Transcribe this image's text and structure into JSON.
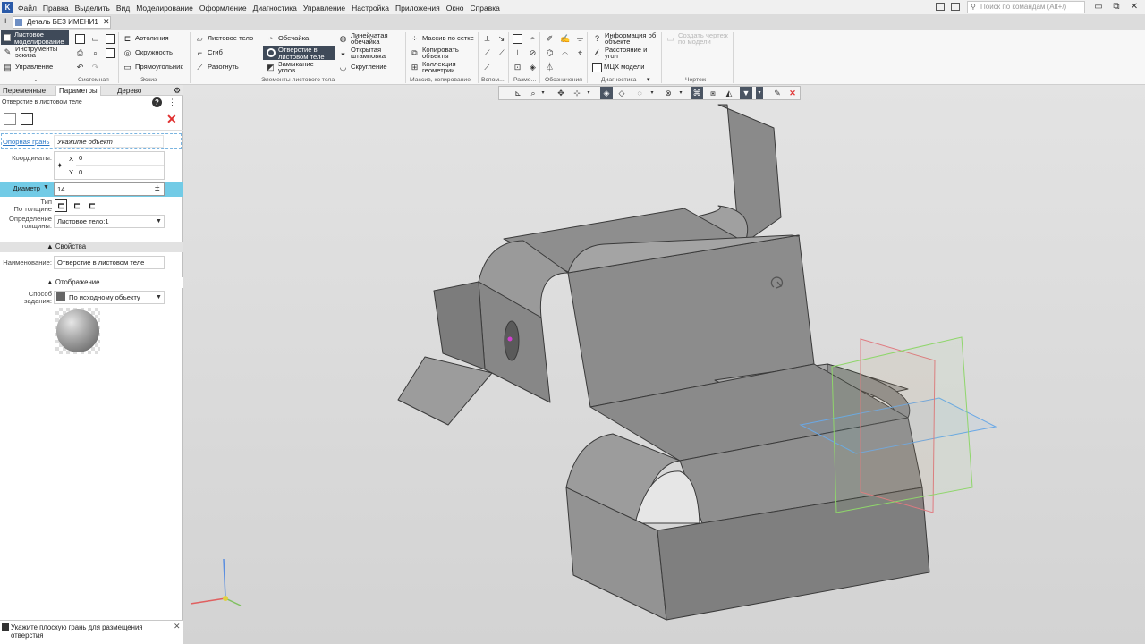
{
  "menu": {
    "items": [
      "Файл",
      "Правка",
      "Выделить",
      "Вид",
      "Моделирование",
      "Оформление",
      "Диагностика",
      "Управление",
      "Настройка",
      "Приложения",
      "Окно",
      "Справка"
    ],
    "search_placeholder": "Поиск по командам (Alt+/)"
  },
  "window": {
    "minimize": "▭",
    "restore": "⧉",
    "close": "✕"
  },
  "doc_tab": {
    "label": "Деталь БЕЗ ИМЕНИ1",
    "add": "+",
    "close": "✕"
  },
  "ribbon": {
    "modes": {
      "sheet": "Листовое моделирование",
      "sketch": "Инструменты эскиза",
      "manage": "Управление"
    },
    "sketch_tools": {
      "autoline": "Автолиния",
      "circle": "Окружность",
      "rect": "Прямоугольник"
    },
    "sheet_tools": {
      "sheet_body": "Листовое тело",
      "bend": "Сгиб",
      "unbend": "Разогнуть",
      "shell": "Обечайка",
      "hole": "Отверстие в листовом теле",
      "close_corners": "Замыкание углов",
      "linear_shell": "Линейчатая обечайка",
      "open_stamp": "Открытая штамповка",
      "rounding": "Скругление"
    },
    "array_tools": {
      "grid_array": "Массив по сетке",
      "copy_objects": "Копировать объекты",
      "geom_collection": "Коллекция геометрии"
    },
    "diag_tools": {
      "obj_info": "Информация об объекте",
      "dist_angle": "Расстояние и угол",
      "mcc": "МЦХ модели"
    },
    "drawing_tools": {
      "create_views": "Создать чертеж по модели"
    },
    "groups": {
      "system": "Системная",
      "sketch": "Эскиз",
      "sheet_elements": "Элементы листового тела",
      "array_copy": "Массив, копирование",
      "aux": "Вспом...",
      "dims": "Разме...",
      "notation": "Обозначения",
      "diagnostics": "Диагностика",
      "drawing": "Чертеж"
    }
  },
  "panel": {
    "tabs": {
      "vars": "Переменные",
      "params": "Параметры",
      "tree": "Дерево"
    },
    "title": "Отверстие в листовом теле",
    "help": "?",
    "cancel": "✕",
    "base_face": {
      "label": "Опорная грань",
      "value": "Укажите объект"
    },
    "coords": {
      "label": "Координаты:",
      "x_label": "X",
      "x": "0",
      "y_label": "Y",
      "y": "0"
    },
    "diameter": {
      "label": "Диаметр",
      "value": "14",
      "tol": "±"
    },
    "type_label": "Тип",
    "thickness_label": "По толщине",
    "thickness_def": {
      "label": "Определение толщины:",
      "value": "Листовое тело:1"
    },
    "props_section": "Свойства",
    "name": {
      "label": "Наименование:",
      "value": "Отверстие в листовом теле"
    },
    "display_section": "Отображение",
    "method": {
      "label": "Способ задания:",
      "value": "По исходному объекту"
    }
  },
  "status": {
    "text": "Укажите плоскую грань для размещения отверстия",
    "close": "✕"
  },
  "colors": {
    "active_mode": "#3f4a59",
    "selected_row": "#72cbe6",
    "cancel": "#e03030",
    "plane_red": "#e07a80",
    "plane_green": "#8fd66b",
    "plane_blue": "#6aa8e6"
  }
}
